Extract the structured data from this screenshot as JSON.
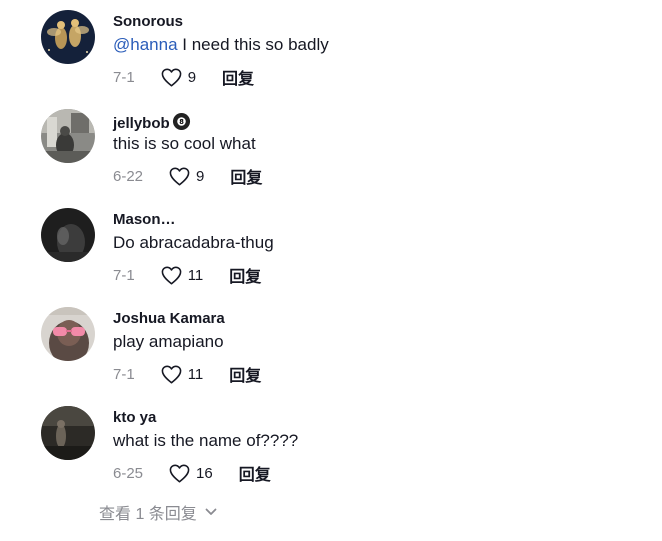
{
  "comments": [
    {
      "username": "Sonorous",
      "mention": "@hanna",
      "text": " I need this so badly",
      "date": "7-1",
      "likes": "9",
      "reply_label": "回复",
      "avatar_desc": "gold fairies on dark navy"
    },
    {
      "username": "jellybob",
      "badge_icon": "8-ball-icon",
      "text": "this is so cool what",
      "date": "6-22",
      "likes": "9",
      "reply_label": "回复",
      "avatar_desc": "black and white photo"
    },
    {
      "username": "Mason…",
      "text": "Do abracadabra-thug",
      "date": "7-1",
      "likes": "11",
      "reply_label": "回复",
      "avatar_desc": "dark photo"
    },
    {
      "username": "Joshua Kamara",
      "text": "play amapiano",
      "date": "7-1",
      "likes": "11",
      "reply_label": "回复",
      "avatar_desc": "person with pink sunglasses"
    },
    {
      "username": "kto ya",
      "text": "what is the name of????",
      "date": "6-25",
      "likes": "16",
      "reply_label": "回复",
      "avatar_desc": "dark landscape photo"
    }
  ],
  "view_replies_label": "查看 1 条回复",
  "colors": {
    "text": "#161823",
    "muted": "#8a8b91",
    "mention": "#2b5db9"
  }
}
